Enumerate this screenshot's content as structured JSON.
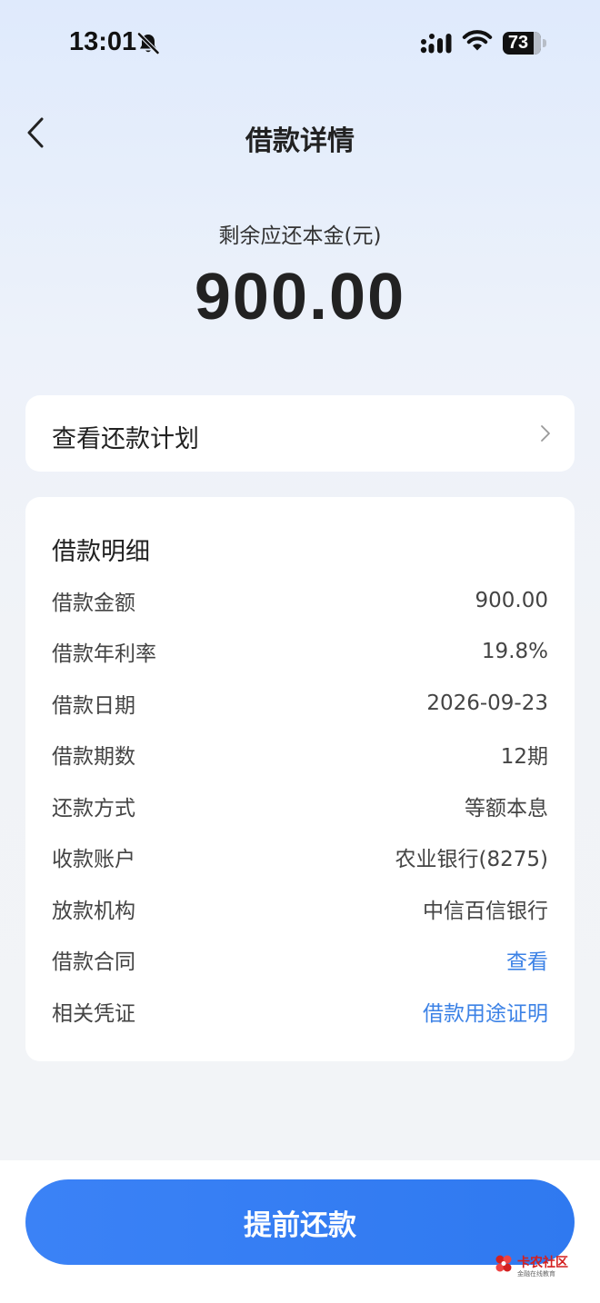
{
  "status_bar": {
    "time": "13:01",
    "battery": "73",
    "icons": [
      "bell-slash-icon",
      "signal-icon",
      "wifi-icon",
      "battery-icon"
    ]
  },
  "nav": {
    "title": "借款详情",
    "back_icon": "chevron-left-icon"
  },
  "summary": {
    "label": "剩余应还本金(元)",
    "amount": "900.00"
  },
  "plan": {
    "label": "查看还款计划",
    "icon": "chevron-right-icon"
  },
  "details": {
    "title": "借款明细",
    "rows": [
      {
        "label": "借款金额",
        "value": "900.00",
        "link": false
      },
      {
        "label": "借款年利率",
        "value": "19.8%",
        "link": false
      },
      {
        "label": "借款日期",
        "value": "2026-09-23",
        "link": false
      },
      {
        "label": "借款期数",
        "value": "12期",
        "link": false
      },
      {
        "label": "还款方式",
        "value": "等额本息",
        "link": false
      },
      {
        "label": "收款账户",
        "value": "农业银行(8275)",
        "link": false
      },
      {
        "label": "放款机构",
        "value": "中信百信银行",
        "link": false
      },
      {
        "label": "借款合同",
        "value": "查看",
        "link": true
      },
      {
        "label": "相关凭证",
        "value": "借款用途证明",
        "link": true
      }
    ]
  },
  "action": {
    "label": "提前还款"
  },
  "watermark": {
    "main": "卡农社区",
    "sub": "金融在线教育"
  },
  "colors": {
    "primary": "#3b82f6",
    "link": "#3c82e6",
    "watermark": "#d32020"
  }
}
